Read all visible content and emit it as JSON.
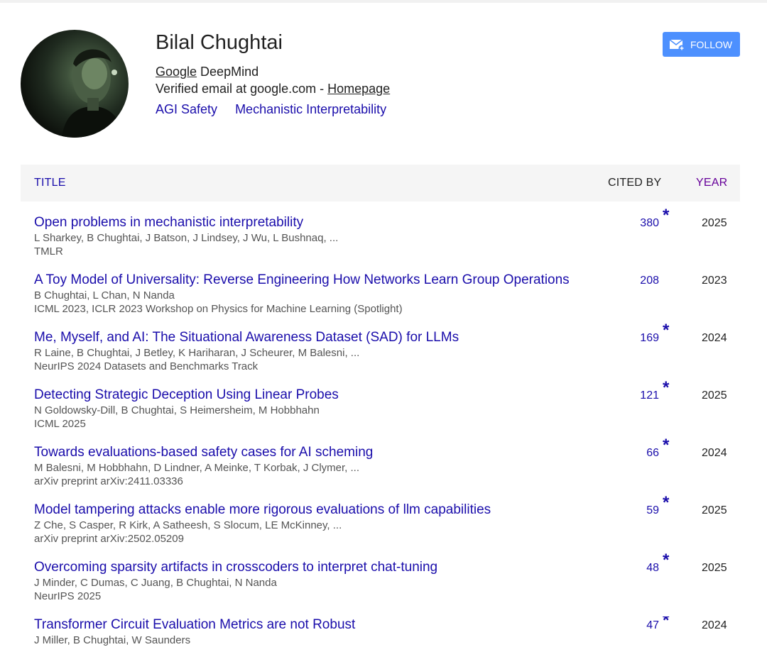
{
  "profile": {
    "name": "Bilal Chughtai",
    "affiliation_link": "Google",
    "affiliation_rest": " DeepMind",
    "email_text": "Verified email at google.com - ",
    "homepage_label": "Homepage",
    "interests": [
      "AGI Safety",
      "Mechanistic Interpretability"
    ],
    "follow_label": "FOLLOW",
    "follow_color": "#4d90fe"
  },
  "table": {
    "headers": {
      "title": "TITLE",
      "cited_by": "CITED BY",
      "year": "YEAR"
    },
    "rows": [
      {
        "title": "Open problems in mechanistic interpretability",
        "authors": "L Sharkey, B Chughtai, J Batson, J Lindsey, J Wu, L Bushnaq, ...",
        "venue": "TMLR",
        "cited_by": "380",
        "star": "*",
        "year": "2025"
      },
      {
        "title": "A Toy Model of Universality: Reverse Engineering How Networks Learn Group Operations",
        "authors": "B Chughtai, L Chan, N Nanda",
        "venue": "ICML 2023, ICLR 2023 Workshop on Physics for Machine Learning (Spotlight)",
        "cited_by": "208",
        "star": "",
        "year": "2023"
      },
      {
        "title": "Me, Myself, and AI: The Situational Awareness Dataset (SAD) for LLMs",
        "authors": "R Laine, B Chughtai, J Betley, K Hariharan, J Scheurer, M Balesni, ...",
        "venue": "NeurIPS 2024 Datasets and Benchmarks Track",
        "cited_by": "169",
        "star": "*",
        "year": "2024"
      },
      {
        "title": "Detecting Strategic Deception Using Linear Probes",
        "authors": "N Goldowsky-Dill, B Chughtai, S Heimersheim, M Hobbhahn",
        "venue": "ICML 2025",
        "cited_by": "121",
        "star": "*",
        "year": "2025"
      },
      {
        "title": "Towards evaluations-based safety cases for AI scheming",
        "authors": "M Balesni, M Hobbhahn, D Lindner, A Meinke, T Korbak, J Clymer, ...",
        "venue": "arXiv preprint arXiv:2411.03336",
        "cited_by": "66",
        "star": "*",
        "year": "2024"
      },
      {
        "title": "Model tampering attacks enable more rigorous evaluations of llm capabilities",
        "authors": "Z Che, S Casper, R Kirk, A Satheesh, S Slocum, LE McKinney, ...",
        "venue": "arXiv preprint arXiv:2502.05209",
        "cited_by": "59",
        "star": "*",
        "year": "2025"
      },
      {
        "title": "Overcoming sparsity artifacts in crosscoders to interpret chat-tuning",
        "authors": "J Minder, C Dumas, C Juang, B Chughtai, N Nanda",
        "venue": "NeurIPS 2025",
        "cited_by": "48",
        "star": "*",
        "year": "2025"
      },
      {
        "title": "Transformer Circuit Evaluation Metrics are not Robust",
        "authors": "J Miller, B Chughtai, W Saunders",
        "venue": "",
        "cited_by": "47",
        "star": "*",
        "year": "2024"
      }
    ]
  },
  "icons": {
    "follow": "envelope-plus-icon",
    "avatar": "profile-photo"
  }
}
